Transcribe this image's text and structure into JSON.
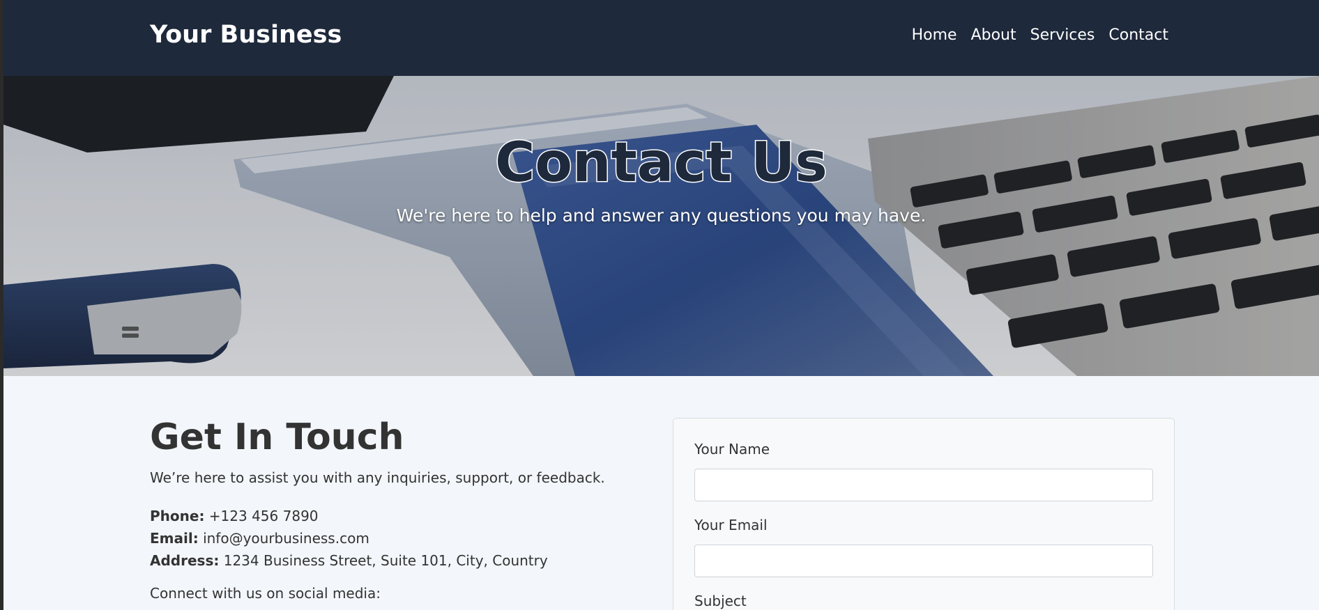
{
  "navbar": {
    "brand": "Your Business",
    "links": [
      "Home",
      "About",
      "Services",
      "Contact"
    ]
  },
  "hero": {
    "title": "Contact Us",
    "subtitle": "We're here to help and answer any questions you may have."
  },
  "contact": {
    "title": "Get In Touch",
    "description": "We’re here to assist you with any inquiries, support, or feedback.",
    "phone_label": "Phone:",
    "phone": "+123 456 7890",
    "email_label": "Email:",
    "email": "info@yourbusiness.com",
    "address_label": "Address:",
    "address": "1234 Business Street, Suite 101, City, Country",
    "social": "Connect with us on social media:"
  },
  "form": {
    "name_label": "Your Name",
    "name_value": "",
    "email_label": "Your Email",
    "email_value": "",
    "subject_label": "Subject"
  },
  "colors": {
    "navbar_bg": "#1e293b",
    "page_bg": "#f3f6fa",
    "text": "#333333"
  }
}
